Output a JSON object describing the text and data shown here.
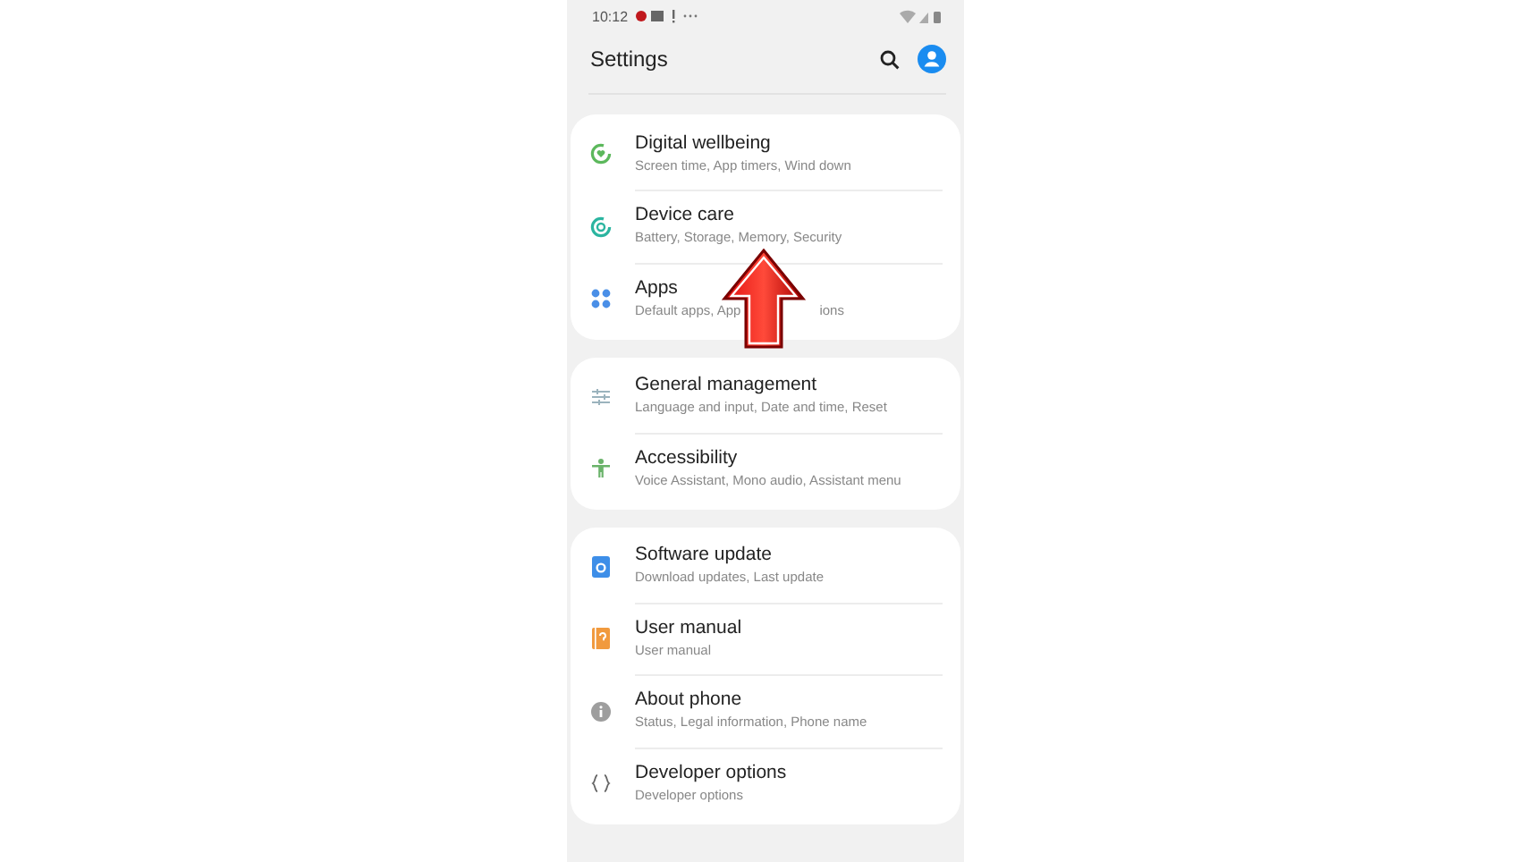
{
  "status_bar": {
    "time": "10:12"
  },
  "header": {
    "title": "Settings"
  },
  "sections": [
    {
      "items": [
        {
          "title": "Digital wellbeing",
          "subtitle": "Screen time, App timers, Wind down"
        },
        {
          "title": "Device care",
          "subtitle": "Battery, Storage, Memory, Security"
        },
        {
          "title": "Apps",
          "subtitle": "Default apps, App",
          "subtitle_tail": "ions"
        }
      ]
    },
    {
      "items": [
        {
          "title": "General management",
          "subtitle": "Language and input, Date and time, Reset"
        },
        {
          "title": "Accessibility",
          "subtitle": "Voice Assistant, Mono audio, Assistant menu"
        }
      ]
    },
    {
      "items": [
        {
          "title": "Software update",
          "subtitle": "Download updates, Last update"
        },
        {
          "title": "User manual",
          "subtitle": "User manual"
        },
        {
          "title": "About phone",
          "subtitle": "Status, Legal information, Phone name"
        },
        {
          "title": "Developer options",
          "subtitle": "Developer options"
        }
      ]
    }
  ]
}
